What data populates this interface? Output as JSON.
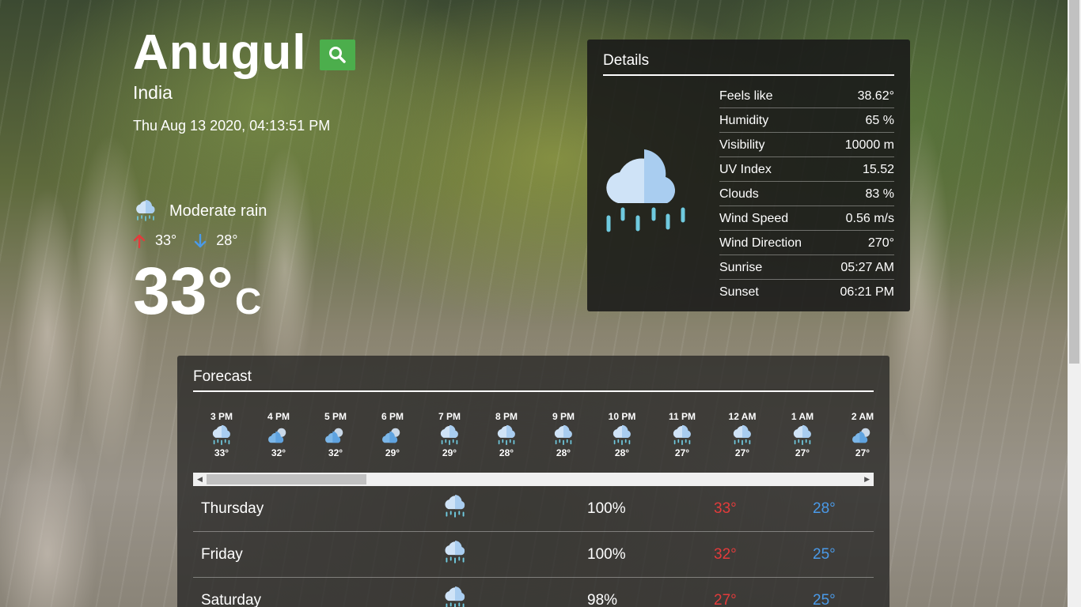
{
  "location": {
    "city": "Anugul",
    "country": "India",
    "datetime": "Thu Aug 13 2020, 04:13:51 PM"
  },
  "current": {
    "condition": "Moderate rain",
    "condition_icon": "rain-cloud-icon",
    "max": "33°",
    "min": "28°",
    "temp": "33°",
    "unit": "C"
  },
  "details": {
    "title": "Details",
    "icon": "rain-cloud-icon",
    "rows": [
      {
        "label": "Feels like",
        "value": "38.62°"
      },
      {
        "label": "Humidity",
        "value": "65 %"
      },
      {
        "label": "Visibility",
        "value": "10000 m"
      },
      {
        "label": "UV Index",
        "value": "15.52"
      },
      {
        "label": "Clouds",
        "value": "83 %"
      },
      {
        "label": "Wind Speed",
        "value": "0.56 m/s"
      },
      {
        "label": "Wind Direction",
        "value": "270°"
      },
      {
        "label": "Sunrise",
        "value": "05:27 AM"
      },
      {
        "label": "Sunset",
        "value": "06:21 PM"
      }
    ]
  },
  "forecast": {
    "title": "Forecast",
    "hourly": [
      {
        "time": "3 PM",
        "temp": "33°",
        "icon": "rain-cloud-icon"
      },
      {
        "time": "4 PM",
        "temp": "32°",
        "icon": "partly-cloudy-icon"
      },
      {
        "time": "5 PM",
        "temp": "32°",
        "icon": "partly-cloudy-icon"
      },
      {
        "time": "6 PM",
        "temp": "29°",
        "icon": "partly-cloudy-icon"
      },
      {
        "time": "7 PM",
        "temp": "29°",
        "icon": "rain-cloud-icon"
      },
      {
        "time": "8 PM",
        "temp": "28°",
        "icon": "rain-cloud-icon"
      },
      {
        "time": "9 PM",
        "temp": "28°",
        "icon": "rain-cloud-icon"
      },
      {
        "time": "10 PM",
        "temp": "28°",
        "icon": "rain-cloud-icon"
      },
      {
        "time": "11 PM",
        "temp": "27°",
        "icon": "rain-cloud-icon"
      },
      {
        "time": "12 AM",
        "temp": "27°",
        "icon": "rain-cloud-icon"
      },
      {
        "time": "1 AM",
        "temp": "27°",
        "icon": "rain-cloud-icon"
      },
      {
        "time": "2 AM",
        "temp": "27°",
        "icon": "partly-cloudy-icon"
      }
    ],
    "daily": [
      {
        "day": "Thursday",
        "precip": "100%",
        "high": "33°",
        "low": "28°",
        "icon": "rain-cloud-icon"
      },
      {
        "day": "Friday",
        "precip": "100%",
        "high": "32°",
        "low": "25°",
        "icon": "rain-cloud-icon"
      },
      {
        "day": "Saturday",
        "precip": "98%",
        "high": "27°",
        "low": "25°",
        "icon": "rain-cloud-icon"
      }
    ]
  },
  "colors": {
    "search_button": "#4cae4c",
    "high_temp": "#e33b3b",
    "low_temp": "#4a9ae8"
  }
}
